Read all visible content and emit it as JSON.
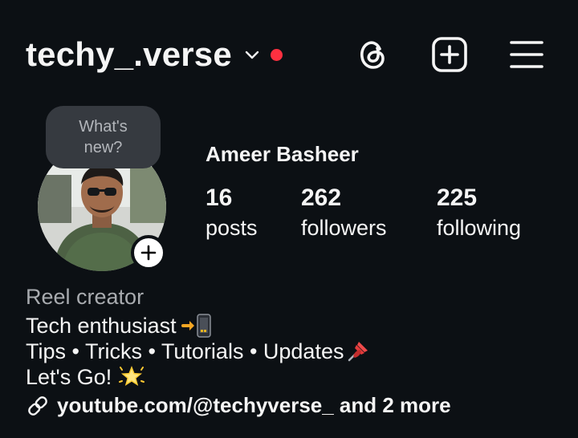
{
  "header": {
    "username": "techy_.verse",
    "icons": {
      "switch": "chevron-down-icon",
      "notification": "red-dot-indicator",
      "threads": "threads-icon",
      "create": "plus-square-icon",
      "menu": "hamburger-menu-icon"
    },
    "colors": {
      "background": "#0c1014",
      "notification_dot": "#ff3040",
      "text": "#f5f5f5"
    }
  },
  "note_bubble": {
    "text": "What's new?"
  },
  "profile": {
    "display_name": "Ameer Basheer",
    "stats": [
      {
        "value": "16",
        "label": "posts"
      },
      {
        "value": "262",
        "label": "followers"
      },
      {
        "value": "225",
        "label": "following"
      }
    ]
  },
  "bio": {
    "category": "Reel creator",
    "lines": [
      "Tech enthusiast",
      "Tips • Tricks • Tutorials • Updates",
      "Let's Go!"
    ],
    "link_text": "youtube.com/@techyverse_ and 2 more",
    "link_icon": "link-icon"
  }
}
